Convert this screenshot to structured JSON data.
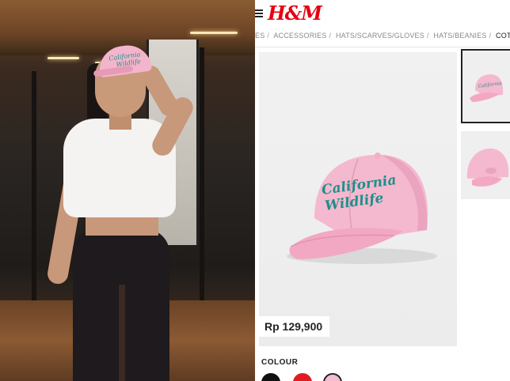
{
  "shop": {
    "brand_logo": "H&M",
    "breadcrumb": [
      "ES",
      "ACCESSORIES",
      "HATS/SCARVES/GLOVES",
      "HATS/BEANIES",
      "COTTON CAP"
    ],
    "product": {
      "cap_text_line1": "California",
      "cap_text_line2": "Wildlife",
      "price": "Rp 129,900"
    },
    "colour_label": "COLOUR",
    "swatches": [
      "#111111",
      "#e01b22",
      "#f3bcd2"
    ]
  },
  "photo": {
    "cap_text_line1": "California",
    "cap_text_line2": "Wildlife"
  },
  "colors": {
    "brand": "#e50010",
    "cap_pink": "#f3b5cb",
    "cap_text": "#1f8f8a"
  }
}
